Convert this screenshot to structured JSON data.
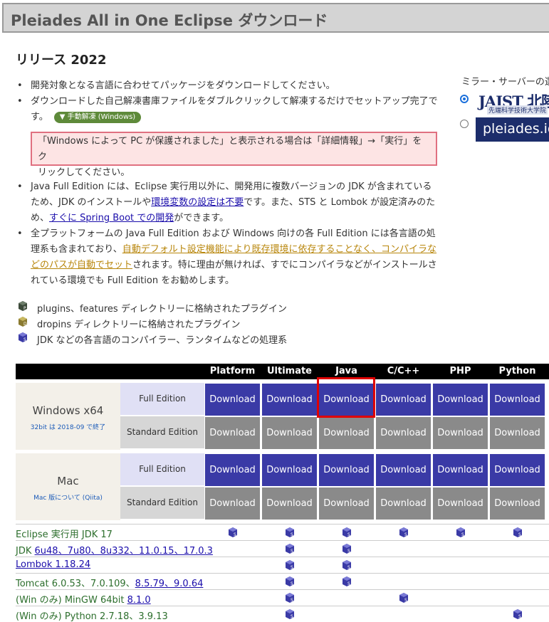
{
  "header": {
    "title": "Pleiades All in One Eclipse ダウンロード"
  },
  "release_title": "リリース 2022",
  "bullets": {
    "b1": "開発対象となる言語に合わせてパッケージをダウンロードしてください。",
    "b2_l1": "ダウンロードした自己解凍書庫ファイルをダブルクリックして解凍するだけでセットアップ完了で",
    "b2_l2": "す。",
    "manual_badge": "▼ 手動解凍 (Windows)",
    "warn_l1": "「Windows によって PC が保護されました」と表示される場合は「詳細情報」→「実行」をク",
    "warn_l2": "リックしてください。",
    "b3_l1": "Java Full Edition には、Eclipse 実行用以外に、開発用に複数バージョンの JDK が含まれている",
    "b3_l2_a": "ため、JDK のインストールや",
    "b3_l2_link": "環境変数の設定は不要",
    "b3_l2_b": "です。また、STS と Lombok が設定済みのた",
    "b3_l3_a": "め、",
    "b3_l3_link": "すぐに Spring Boot での開発",
    "b3_l3_b": "ができます。",
    "b4_l1": "全プラットフォームの Java Full Edition および Windows 向けの各 Full Edition には各言語の処",
    "b4_l2_a": "理系も含まれており、",
    "b4_l2_link": "自動デフォルト設定機能により既存環境に依存することなく、コンパイラな",
    "b4_l3_link": "どのパスが自動でセット",
    "b4_l3_b": "されます。特に理由が無ければ、すでにコンパイラなどがインストールさ",
    "b4_l4": "れている環境でも Full Edition をお勧めします。"
  },
  "mirror": {
    "label": "ミラー・サーバーの選",
    "jaist_big": "JAIST 北陸",
    "jaist_sub": "先端科学技術大学院",
    "pleiades": "pleiades.io"
  },
  "legend": [
    {
      "icon": "plugin-cube-icon",
      "text": "plugins、features ディレクトリーに格納されたプラグイン"
    },
    {
      "icon": "dropins-cube-icon",
      "text": "dropins ディレクトリーに格納されたプラグイン"
    },
    {
      "icon": "system-cube-icon",
      "text": "JDK などの各言語のコンパイラー、ランタイムなどの処理系"
    }
  ],
  "table": {
    "columns": [
      "Platform",
      "Ultimate",
      "Java",
      "C/C++",
      "PHP",
      "Python"
    ],
    "download_label": "Download",
    "windows": {
      "name": "Windows x64",
      "note": "32bit は 2018-09 で終了"
    },
    "mac": {
      "name": "Mac",
      "note": "Mac 版について (Qiita)"
    },
    "full_edition": "Full Edition",
    "standard_edition": "Standard Edition"
  },
  "components": [
    {
      "pre": "Eclipse 実行用 JDK 17",
      "link": "",
      "cols": [
        0,
        1,
        2,
        3,
        4,
        5
      ]
    },
    {
      "pre": "JDK ",
      "link": "6u48、7u80、8u332、11.0.15、17.0.3",
      "cols": [
        1,
        2
      ]
    },
    {
      "pre": "",
      "link": "Lombok 1.18.24",
      "cols": [
        1,
        2
      ]
    },
    {
      "pre": "Tomcat 6.0.53、7.0.109、",
      "link": "8.5.79、9.0.64",
      "cols": [
        1,
        2
      ]
    },
    {
      "pre": "(Win のみ) MinGW 64bit ",
      "link": "8.1.0",
      "cols": [
        1,
        3
      ]
    },
    {
      "pre": "(Win のみ) Python 2.7.18、3.9.13",
      "link": "",
      "cols": [
        1,
        5
      ]
    }
  ],
  "colors": {
    "full_download": "#3a3aa6",
    "standard_download": "#8a8a8a",
    "highlight": "#e00000"
  }
}
